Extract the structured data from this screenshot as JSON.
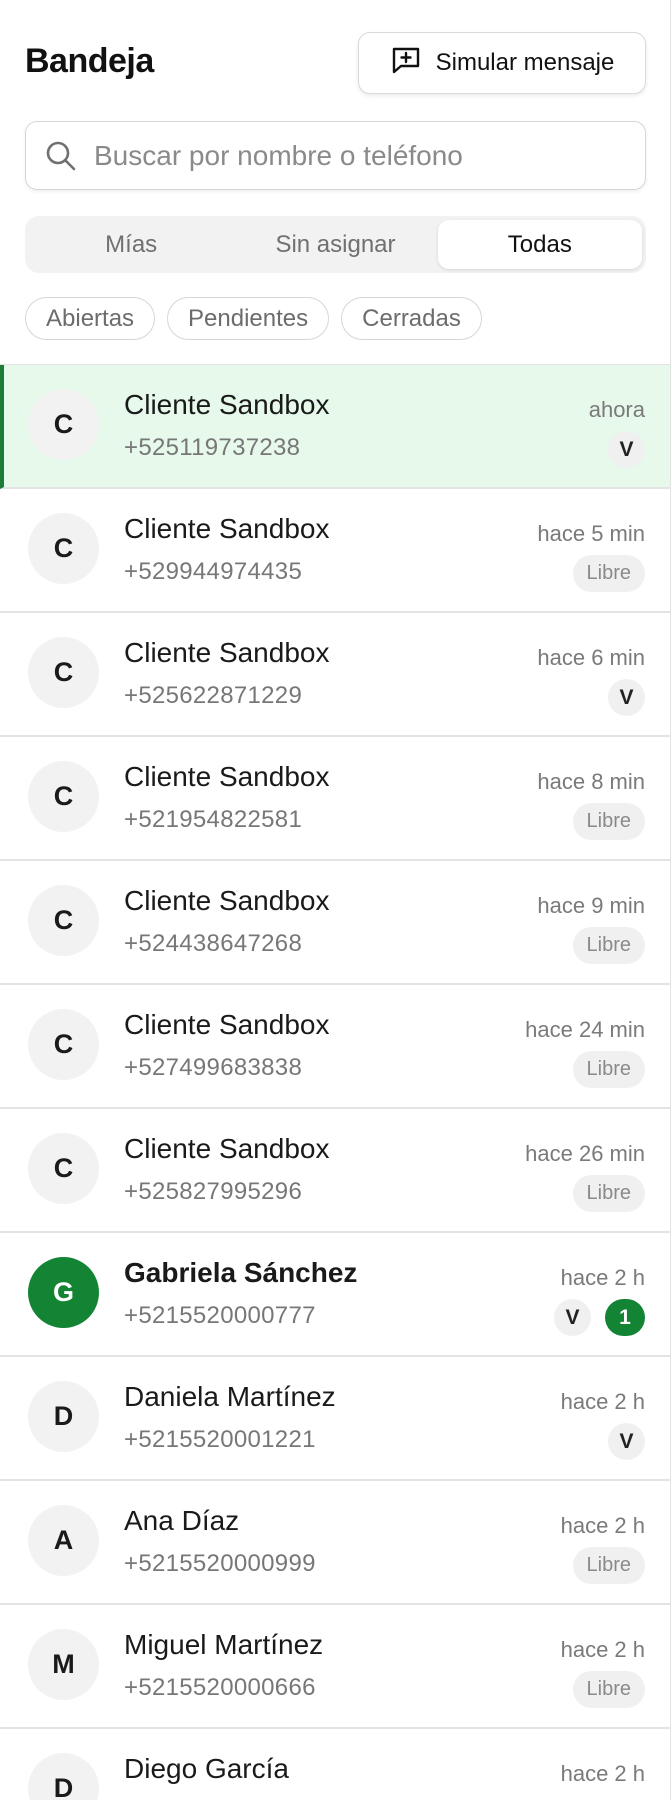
{
  "header": {
    "title": "Bandeja",
    "simulate_label": "Simular mensaje"
  },
  "search": {
    "placeholder": "Buscar por nombre o teléfono"
  },
  "tabs": [
    "Mías",
    "Sin asignar",
    "Todas"
  ],
  "active_tab": "Todas",
  "filters": [
    "Abiertas",
    "Pendientes",
    "Cerradas"
  ],
  "colors": {
    "accent": "#128434",
    "selected_bg": "#e6f9ea"
  },
  "conversations": [
    {
      "initial": "C",
      "name": "Cliente Sandbox",
      "phone": "+525119737238",
      "time": "ahora",
      "assignee": "V",
      "selected": true
    },
    {
      "initial": "C",
      "name": "Cliente Sandbox",
      "phone": "+529944974435",
      "time": "hace 5 min",
      "status": "Libre"
    },
    {
      "initial": "C",
      "name": "Cliente Sandbox",
      "phone": "+525622871229",
      "time": "hace 6 min",
      "assignee": "V"
    },
    {
      "initial": "C",
      "name": "Cliente Sandbox",
      "phone": "+521954822581",
      "time": "hace 8 min",
      "status": "Libre"
    },
    {
      "initial": "C",
      "name": "Cliente Sandbox",
      "phone": "+524438647268",
      "time": "hace 9 min",
      "status": "Libre"
    },
    {
      "initial": "C",
      "name": "Cliente Sandbox",
      "phone": "+527499683838",
      "time": "hace 24 min",
      "status": "Libre"
    },
    {
      "initial": "C",
      "name": "Cliente Sandbox",
      "phone": "+525827995296",
      "time": "hace 26 min",
      "status": "Libre"
    },
    {
      "initial": "G",
      "name": "Gabriela Sánchez",
      "phone": "+5215520000777",
      "time": "hace 2 h",
      "assignee": "V",
      "unread": "1",
      "bold": true
    },
    {
      "initial": "D",
      "name": "Daniela Martínez",
      "phone": "+5215520001221",
      "time": "hace 2 h",
      "assignee": "V"
    },
    {
      "initial": "A",
      "name": "Ana Díaz",
      "phone": "+5215520000999",
      "time": "hace 2 h",
      "status": "Libre"
    },
    {
      "initial": "M",
      "name": "Miguel Martínez",
      "phone": "+5215520000666",
      "time": "hace 2 h",
      "status": "Libre"
    },
    {
      "initial": "D",
      "name": "Diego García",
      "phone": "",
      "time": "hace 2 h"
    }
  ]
}
